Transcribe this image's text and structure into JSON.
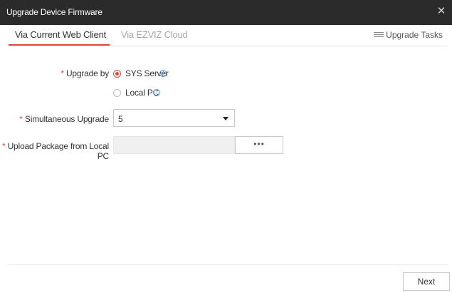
{
  "window": {
    "title": "Upgrade Device Firmware",
    "close_icon": "close-icon",
    "close_glyph": "✕"
  },
  "tabs": [
    {
      "label": "Via Current Web Client",
      "active": true
    },
    {
      "label": "Via EZVIZ Cloud",
      "active": false
    }
  ],
  "tasks_link": {
    "label": "Upgrade Tasks",
    "icon": "list-icon"
  },
  "required_marker": "*",
  "form": {
    "upgrade_by": {
      "label": "Upgrade by",
      "options": [
        {
          "label": "SYS Server",
          "checked": true,
          "info_icon": "info-icon"
        },
        {
          "label": "Local PC",
          "checked": false,
          "info_icon": "info-icon"
        }
      ]
    },
    "simultaneous_upgrade": {
      "label": "Simultaneous Upgrade",
      "value": "5"
    },
    "upload_package": {
      "label": "Upload Package from Local PC",
      "value": "",
      "browse_label": "•••"
    }
  },
  "footer": {
    "next_label": "Next"
  },
  "colors": {
    "accent": "#e6493a",
    "titlebar": "#2b2b2b",
    "info": "#5a9bea"
  }
}
